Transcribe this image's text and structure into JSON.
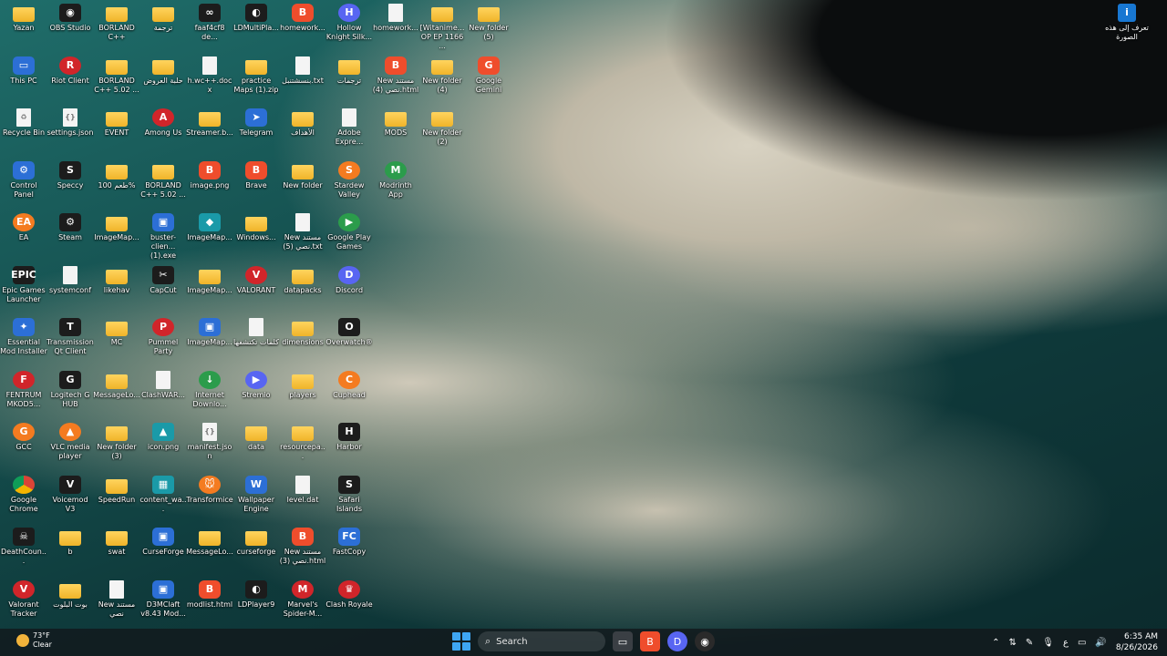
{
  "desktop": {
    "icons": [
      {
        "label": "Yazan",
        "kind": "folder",
        "glyph": "",
        "col": 0,
        "row": 0
      },
      {
        "label": "This PC",
        "kind": "app",
        "glyph": "▭",
        "col": 0,
        "row": 1
      },
      {
        "label": "Recycle Bin",
        "kind": "file",
        "glyph": "♻",
        "col": 0,
        "row": 2
      },
      {
        "label": "Control Panel",
        "kind": "app",
        "glyph": "⚙",
        "col": 0,
        "row": 3
      },
      {
        "label": "EA",
        "kind": "orange",
        "glyph": "EA",
        "col": 0,
        "row": 4
      },
      {
        "label": "Epic Games Launcher",
        "kind": "dark",
        "glyph": "EPIC",
        "col": 0,
        "row": 5
      },
      {
        "label": "Essential Mod Installer",
        "kind": "app",
        "glyph": "✦",
        "col": 0,
        "row": 6
      },
      {
        "label": "FENTRUM MKOD5...",
        "kind": "red",
        "glyph": "F",
        "col": 0,
        "row": 7
      },
      {
        "label": "GCC",
        "kind": "orange",
        "glyph": "G",
        "col": 0,
        "row": 8
      },
      {
        "label": "Google Chrome",
        "kind": "chrome",
        "glyph": "",
        "col": 0,
        "row": 9
      },
      {
        "label": "DeathCoun...",
        "kind": "dark",
        "glyph": "☠",
        "col": 0,
        "row": 10
      },
      {
        "label": "Valorant Tracker",
        "kind": "red",
        "glyph": "V",
        "col": 0,
        "row": 11
      },
      {
        "label": "OBS Studio",
        "kind": "dark",
        "glyph": "◉",
        "col": 1,
        "row": 0
      },
      {
        "label": "Riot Client",
        "kind": "red",
        "glyph": "R",
        "col": 1,
        "row": 1
      },
      {
        "label": "settings.json",
        "kind": "file",
        "glyph": "{}",
        "col": 1,
        "row": 2
      },
      {
        "label": "Speccy",
        "kind": "dark",
        "glyph": "S",
        "col": 1,
        "row": 3
      },
      {
        "label": "Steam",
        "kind": "dark",
        "glyph": "⚙",
        "col": 1,
        "row": 4
      },
      {
        "label": "systemconf",
        "kind": "file",
        "glyph": "",
        "col": 1,
        "row": 5
      },
      {
        "label": "Transmission Qt Client",
        "kind": "dark",
        "glyph": "T",
        "col": 1,
        "row": 6
      },
      {
        "label": "Logitech G HUB",
        "kind": "dark",
        "glyph": "G",
        "col": 1,
        "row": 7
      },
      {
        "label": "VLC media player",
        "kind": "orange",
        "glyph": "▲",
        "col": 1,
        "row": 8
      },
      {
        "label": "Voicemod V3",
        "kind": "dark",
        "glyph": "V",
        "col": 1,
        "row": 9
      },
      {
        "label": "b",
        "kind": "folder",
        "glyph": "",
        "col": 1,
        "row": 10
      },
      {
        "label": "بوت البلوت",
        "kind": "folder",
        "glyph": "",
        "col": 1,
        "row": 11
      },
      {
        "label": "BORLAND C++",
        "kind": "folder",
        "glyph": "",
        "col": 2,
        "row": 0
      },
      {
        "label": "BORLAND C++ 5.02 ...",
        "kind": "folder",
        "glyph": "",
        "col": 2,
        "row": 1
      },
      {
        "label": "EVENT",
        "kind": "folder",
        "glyph": "",
        "col": 2,
        "row": 2
      },
      {
        "label": "طعم 100%",
        "kind": "folder",
        "glyph": "",
        "col": 2,
        "row": 3
      },
      {
        "label": "ImageMap...",
        "kind": "folder",
        "glyph": "",
        "col": 2,
        "row": 4
      },
      {
        "label": "likehav",
        "kind": "folder",
        "glyph": "",
        "col": 2,
        "row": 5
      },
      {
        "label": "MC",
        "kind": "folder",
        "glyph": "",
        "col": 2,
        "row": 6
      },
      {
        "label": "MessageLo...",
        "kind": "folder",
        "glyph": "",
        "col": 2,
        "row": 7
      },
      {
        "label": "New folder (3)",
        "kind": "folder",
        "glyph": "",
        "col": 2,
        "row": 8
      },
      {
        "label": "SpeedRun",
        "kind": "folder",
        "glyph": "",
        "col": 2,
        "row": 9
      },
      {
        "label": "swat",
        "kind": "folder",
        "glyph": "",
        "col": 2,
        "row": 10
      },
      {
        "label": "New مستند نصي",
        "kind": "file",
        "glyph": "",
        "col": 2,
        "row": 11
      },
      {
        "label": "ترجمة",
        "kind": "folder",
        "glyph": "",
        "col": 3,
        "row": 0
      },
      {
        "label": "حلبة العروض",
        "kind": "folder",
        "glyph": "",
        "col": 3,
        "row": 1
      },
      {
        "label": "Among Us",
        "kind": "red",
        "glyph": "A",
        "col": 3,
        "row": 2
      },
      {
        "label": "BORLAND C++ 5.02 ...",
        "kind": "folder",
        "glyph": "",
        "col": 3,
        "row": 3
      },
      {
        "label": "buster-clien... (1).exe",
        "kind": "app",
        "glyph": "▣",
        "col": 3,
        "row": 4
      },
      {
        "label": "CapCut",
        "kind": "dark",
        "glyph": "✂",
        "col": 3,
        "row": 5
      },
      {
        "label": "Pummel Party",
        "kind": "red",
        "glyph": "P",
        "col": 3,
        "row": 6
      },
      {
        "label": "ClashWAR...",
        "kind": "file",
        "glyph": "",
        "col": 3,
        "row": 7
      },
      {
        "label": "icon.png",
        "kind": "teal",
        "glyph": "▲",
        "col": 3,
        "row": 8
      },
      {
        "label": "content_wa...",
        "kind": "teal",
        "glyph": "▦",
        "col": 3,
        "row": 9
      },
      {
        "label": "CurseForge",
        "kind": "app",
        "glyph": "▣",
        "col": 3,
        "row": 10
      },
      {
        "label": "D3MClaft v8.43 Mod...",
        "kind": "app",
        "glyph": "▣",
        "col": 3,
        "row": 11
      },
      {
        "label": "faaf4cf8 de...",
        "kind": "dark",
        "glyph": "∞",
        "col": 4,
        "row": 0
      },
      {
        "label": "h.wc++.docx",
        "kind": "file",
        "glyph": "",
        "col": 4,
        "row": 1
      },
      {
        "label": "Streamer.b...",
        "kind": "folder",
        "glyph": "",
        "col": 4,
        "row": 2
      },
      {
        "label": "image.png",
        "kind": "brave",
        "glyph": "B",
        "col": 4,
        "row": 3
      },
      {
        "label": "ImageMap...",
        "kind": "teal",
        "glyph": "◆",
        "col": 4,
        "row": 4
      },
      {
        "label": "ImageMap...",
        "kind": "folder",
        "glyph": "",
        "col": 4,
        "row": 5
      },
      {
        "label": "ImageMap...",
        "kind": "app",
        "glyph": "▣",
        "col": 4,
        "row": 6
      },
      {
        "label": "Internet Downlo...",
        "kind": "green",
        "glyph": "↓",
        "col": 4,
        "row": 7
      },
      {
        "label": "manifest.json",
        "kind": "file",
        "glyph": "{}",
        "col": 4,
        "row": 8
      },
      {
        "label": "Transformice",
        "kind": "orange",
        "glyph": "🐭",
        "col": 4,
        "row": 9
      },
      {
        "label": "MessageLo...",
        "kind": "folder",
        "glyph": "",
        "col": 4,
        "row": 10
      },
      {
        "label": "modlist.html",
        "kind": "brave",
        "glyph": "B",
        "col": 4,
        "row": 11
      },
      {
        "label": "LDMultiPla...",
        "kind": "dark",
        "glyph": "◐",
        "col": 5,
        "row": 0
      },
      {
        "label": "practice Maps (1).zip",
        "kind": "folder",
        "glyph": "",
        "col": 5,
        "row": 1
      },
      {
        "label": "Telegram",
        "kind": "app",
        "glyph": "➤",
        "col": 5,
        "row": 2
      },
      {
        "label": "Brave",
        "kind": "brave",
        "glyph": "B",
        "col": 5,
        "row": 3
      },
      {
        "label": "Windows...",
        "kind": "folder",
        "glyph": "",
        "col": 5,
        "row": 4
      },
      {
        "label": "VALORANT",
        "kind": "red",
        "glyph": "V",
        "col": 5,
        "row": 5
      },
      {
        "label": "كلمات تكتشفها",
        "kind": "file",
        "glyph": "",
        "col": 5,
        "row": 6
      },
      {
        "label": "Stremio",
        "kind": "purple",
        "glyph": "▶",
        "col": 5,
        "row": 7
      },
      {
        "label": "data",
        "kind": "folder",
        "glyph": "",
        "col": 5,
        "row": 8
      },
      {
        "label": "Wallpaper Engine",
        "kind": "app",
        "glyph": "W",
        "col": 5,
        "row": 9
      },
      {
        "label": "curseforge",
        "kind": "folder",
        "glyph": "",
        "col": 5,
        "row": 10
      },
      {
        "label": "LDPlayer9",
        "kind": "dark",
        "glyph": "◐",
        "col": 5,
        "row": 11
      },
      {
        "label": "homework...",
        "kind": "brave",
        "glyph": "B",
        "col": 6,
        "row": 0
      },
      {
        "label": "بنسشتنبل.txt",
        "kind": "file",
        "glyph": "",
        "col": 6,
        "row": 1
      },
      {
        "label": "الأهداف",
        "kind": "folder",
        "glyph": "",
        "col": 6,
        "row": 2
      },
      {
        "label": "New folder",
        "kind": "folder",
        "glyph": "",
        "col": 6,
        "row": 3
      },
      {
        "label": "New مستند نصي (5).txt",
        "kind": "file",
        "glyph": "",
        "col": 6,
        "row": 4
      },
      {
        "label": "datapacks",
        "kind": "folder",
        "glyph": "",
        "col": 6,
        "row": 5
      },
      {
        "label": "dimensions",
        "kind": "folder",
        "glyph": "",
        "col": 6,
        "row": 6
      },
      {
        "label": "players",
        "kind": "folder",
        "glyph": "",
        "col": 6,
        "row": 7
      },
      {
        "label": "resourcepa...",
        "kind": "folder",
        "glyph": "",
        "col": 6,
        "row": 8
      },
      {
        "label": "level.dat",
        "kind": "file",
        "glyph": "",
        "col": 6,
        "row": 9
      },
      {
        "label": "New مستند نصي (3).html",
        "kind": "brave",
        "glyph": "B",
        "col": 6,
        "row": 10
      },
      {
        "label": "Marvel's Spider-M...",
        "kind": "red",
        "glyph": "M",
        "col": 6,
        "row": 11
      },
      {
        "label": "Hollow Knight Silk...",
        "kind": "purple",
        "glyph": "H",
        "col": 7,
        "row": 0
      },
      {
        "label": "ترجمات",
        "kind": "folder",
        "glyph": "",
        "col": 7,
        "row": 1
      },
      {
        "label": "Adobe Expre...",
        "kind": "file",
        "glyph": "",
        "col": 7,
        "row": 2
      },
      {
        "label": "Stardew Valley",
        "kind": "orange",
        "glyph": "S",
        "col": 7,
        "row": 3
      },
      {
        "label": "Google Play Games",
        "kind": "green",
        "glyph": "▶",
        "col": 7,
        "row": 4
      },
      {
        "label": "Discord",
        "kind": "purple",
        "glyph": "D",
        "col": 7,
        "row": 5
      },
      {
        "label": "Overwatch®",
        "kind": "dark",
        "glyph": "O",
        "col": 7,
        "row": 6
      },
      {
        "label": "Cuphead",
        "kind": "orange",
        "glyph": "C",
        "col": 7,
        "row": 7
      },
      {
        "label": "Harbor",
        "kind": "dark",
        "glyph": "H",
        "col": 7,
        "row": 8
      },
      {
        "label": "Safari Islands",
        "kind": "dark",
        "glyph": "S",
        "col": 7,
        "row": 9
      },
      {
        "label": "FastCopy",
        "kind": "app",
        "glyph": "FC",
        "col": 7,
        "row": 10
      },
      {
        "label": "Clash Royale",
        "kind": "red",
        "glyph": "♛",
        "col": 7,
        "row": 11
      },
      {
        "label": "homework...",
        "kind": "file",
        "glyph": "",
        "col": 8,
        "row": 0
      },
      {
        "label": "New مستند نصي (4).html",
        "kind": "brave",
        "glyph": "B",
        "col": 8,
        "row": 1
      },
      {
        "label": "MODS",
        "kind": "folder",
        "glyph": "",
        "col": 8,
        "row": 2
      },
      {
        "label": "Modrinth App",
        "kind": "green",
        "glyph": "M",
        "col": 8,
        "row": 3
      },
      {
        "label": "[Witanime... OP EP 1166 ...",
        "kind": "folder",
        "glyph": "",
        "col": 9,
        "row": 0
      },
      {
        "label": "New folder (4)",
        "kind": "folder",
        "glyph": "",
        "col": 9,
        "row": 1
      },
      {
        "label": "New folder (2)",
        "kind": "folder",
        "glyph": "",
        "col": 9,
        "row": 2
      },
      {
        "label": "New folder (5)",
        "kind": "folder",
        "glyph": "",
        "col": 10,
        "row": 0
      },
      {
        "label": "Google Gemini",
        "kind": "brave",
        "glyph": "G",
        "col": 10,
        "row": 1
      }
    ]
  },
  "corner_info": {
    "label": "تعرف إلى هذه الصورة",
    "icon": "info-camera-icon"
  },
  "taskbar": {
    "weather": {
      "temp": "73°F",
      "condition": "Clear"
    },
    "search_placeholder": "Search",
    "time": "6:35 AM",
    "date": "8/26/2026",
    "language": "ع"
  }
}
